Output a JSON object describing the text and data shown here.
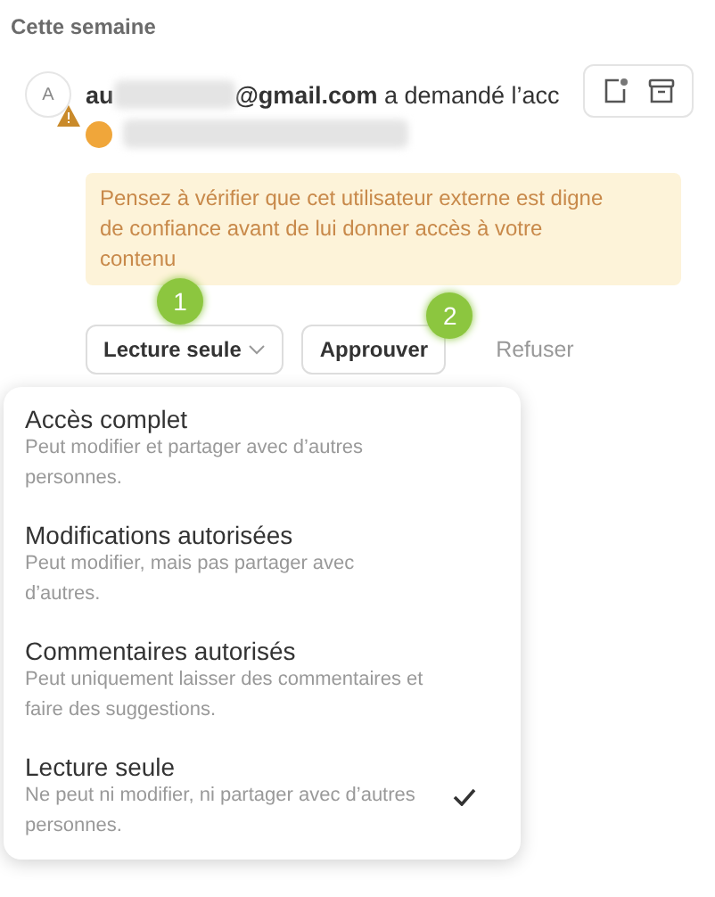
{
  "section_title": "Cette semaine",
  "notification": {
    "avatar": "A",
    "email_start": "au",
    "email_end": "@gmail.com",
    "message": "a demandé l’acc",
    "warning": "Pensez à vérifier que cet utilisateur externe est digne de confiance avant de lui donner accès à votre contenu",
    "permission_button": "Lecture seule",
    "approve_button": "Approuver",
    "reject_button": "Refuser"
  },
  "callouts": [
    "1",
    "2"
  ],
  "menu": [
    {
      "title": "Accès complet",
      "description": "Peut modifier et partager avec d’autres personnes.",
      "selected": false
    },
    {
      "title": "Modifications autorisées",
      "description": "Peut modifier, mais pas partager avec d’autres.",
      "selected": false
    },
    {
      "title": "Commentaires autorisés",
      "description": "Peut uniquement laisser des commentaires et faire des suggestions.",
      "selected": false
    },
    {
      "title": "Lecture seule",
      "description": "Ne peut ni modifier, ni partager avec d’autres personnes.",
      "selected": true
    }
  ]
}
